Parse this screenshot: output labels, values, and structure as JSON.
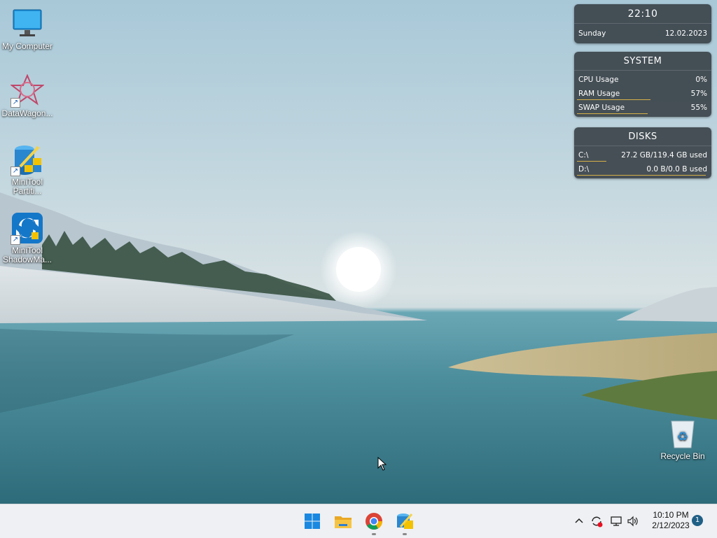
{
  "desktop": {
    "icons": [
      {
        "label": "My Computer",
        "icon": "monitor-icon"
      },
      {
        "label": "DataWagon...",
        "icon": "datawagon-icon"
      },
      {
        "label": "MiniTool Partiti...",
        "icon": "minitool-partition-icon"
      },
      {
        "label": "MiniTool ShadowMa...",
        "icon": "minitool-shadowmaker-icon"
      },
      {
        "label": "Recycle Bin",
        "icon": "recycle-bin-icon"
      }
    ]
  },
  "widgets": {
    "clock": {
      "time": "22:10",
      "day": "Sunday",
      "date": "12.02.2023"
    },
    "system": {
      "title": "SYSTEM",
      "rows": [
        {
          "label": "CPU Usage",
          "value": "0%",
          "level": 0
        },
        {
          "label": "RAM Usage",
          "value": "57%",
          "level": 0.57
        },
        {
          "label": "SWAP Usage",
          "value": "55%",
          "level": 0.55
        }
      ]
    },
    "disks": {
      "title": "DISKS",
      "rows": [
        {
          "label": "C:\\",
          "value": "27.2 GB/119.4 GB used",
          "level": 0.23
        },
        {
          "label": "D:\\",
          "value": "0.0 B/0.0 B used",
          "level": 1
        }
      ]
    }
  },
  "taskbar": {
    "pinned": [
      {
        "name": "start-button",
        "icon": "windows-logo-icon"
      },
      {
        "name": "file-explorer-button",
        "icon": "folder-icon"
      },
      {
        "name": "chrome-button",
        "icon": "chrome-icon"
      },
      {
        "name": "minitool-button",
        "icon": "minitool-partition-icon"
      }
    ],
    "tray": {
      "icons": [
        "chevron-up-icon",
        "sync-alert-icon",
        "network-icon",
        "speaker-icon"
      ],
      "time": "10:10 PM",
      "date": "2/12/2023",
      "notification_count": "1"
    }
  },
  "colors": {
    "widget_bar": "#d8b04a",
    "taskbar_bg": "#eef0f3",
    "notif_badge": "#1f5f86"
  }
}
